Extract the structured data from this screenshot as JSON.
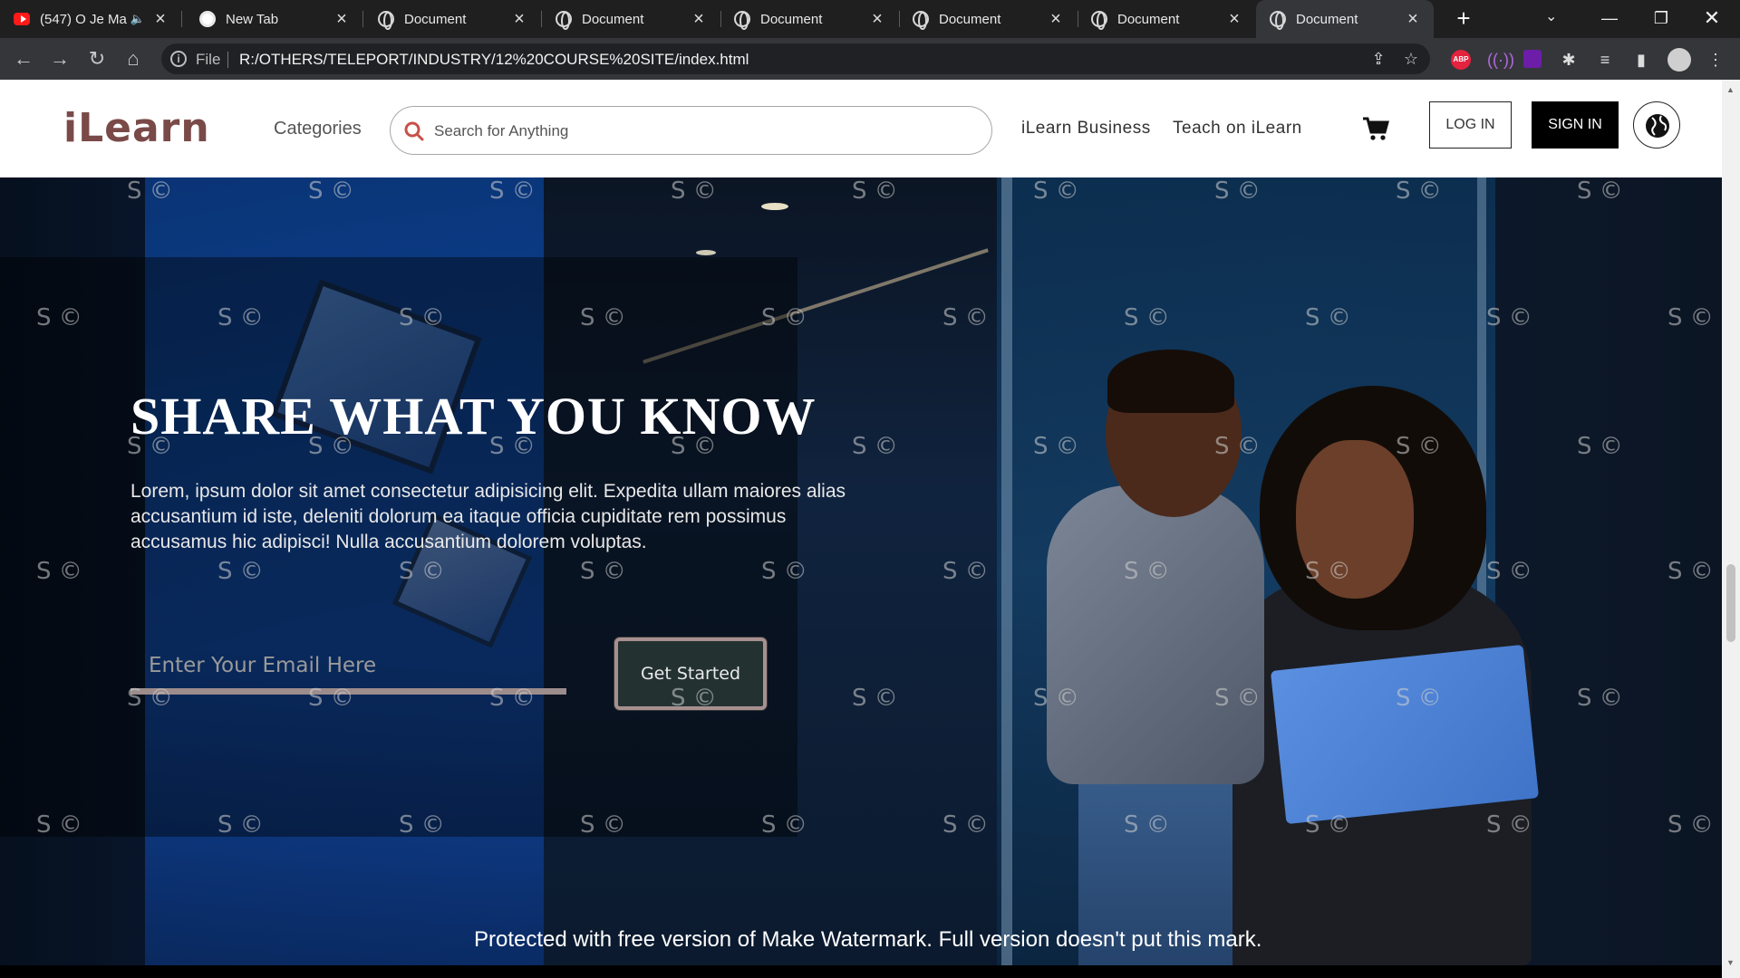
{
  "browser": {
    "tabs": [
      {
        "label": "(547) O Je Ma",
        "icon": "youtube-icon",
        "muted_icon": "speaker-icon"
      },
      {
        "label": "New Tab",
        "icon": "chrome-icon"
      },
      {
        "label": "Document",
        "icon": "globe-icon"
      },
      {
        "label": "Document",
        "icon": "globe-icon"
      },
      {
        "label": "Document",
        "icon": "globe-icon"
      },
      {
        "label": "Document",
        "icon": "globe-icon"
      },
      {
        "label": "Document",
        "icon": "globe-icon"
      },
      {
        "label": "Document",
        "icon": "globe-icon",
        "active": true
      }
    ],
    "address": {
      "scheme_label": "File",
      "url": "R:/OTHERS/TELEPORT/INDUSTRY/12%20COURSE%20SITE/index.html"
    },
    "extension_abp": "ABP"
  },
  "site": {
    "logo": "iLearn",
    "nav": {
      "categories": "Categories",
      "search_placeholder": "Search for Anything",
      "business": "iLearn Business",
      "teach": "Teach on iLearn",
      "login": "LOG IN",
      "signin": "SIGN IN"
    },
    "hero": {
      "title": "SHARE WHAT YOU KNOW",
      "description": "Lorem, ipsum dolor sit amet consectetur adipisicing elit. Expedita ullam maiores alias accusantium id iste, deleniti dolorum ea itaque officia cupiditate rem possimus accusamus hic adipisci! Nulla accusantium dolorem voluptas.",
      "email_placeholder": "Enter Your Email Here",
      "cta": "Get Started"
    }
  },
  "watermark": {
    "mark": "S ©",
    "banner": "Protected with free version of Make Watermark. Full version doesn't put this mark."
  },
  "colors": {
    "logo": "#7a4a48",
    "search_icon": "#c8504a",
    "cta_bg": "#233231",
    "cta_border": "#a89090"
  }
}
